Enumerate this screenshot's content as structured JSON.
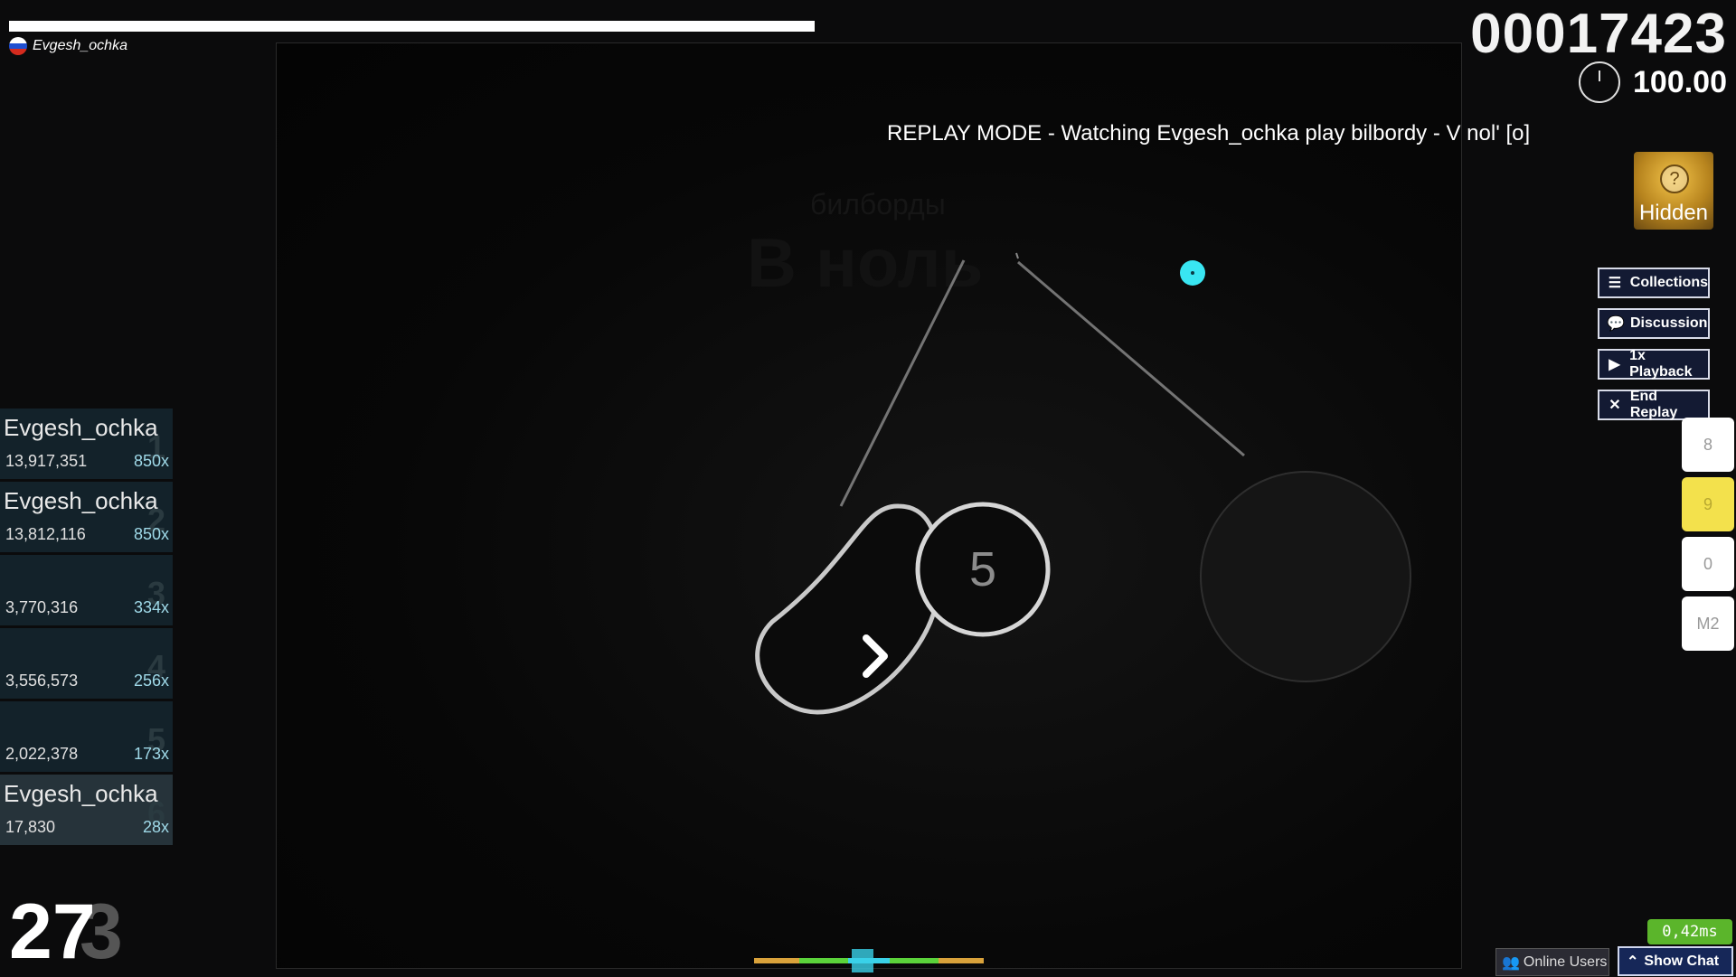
{
  "hud": {
    "player_name": "Evgesh_ochka",
    "score": "00017423",
    "accuracy": "100.00",
    "combo": "27",
    "combo_ghost": "3"
  },
  "replay_banner": "REPLAY MODE - Watching Evgesh_ochka play bilbordy - V nol' [o]",
  "background_titles": {
    "artist": "билборды",
    "title": "В ноль"
  },
  "mods": {
    "hidden_label": "Hidden",
    "hidden_glyph": "?"
  },
  "side_buttons": [
    {
      "label": "Collections",
      "icon": "list-icon"
    },
    {
      "label": "Discussion",
      "icon": "chat-bubbles-icon"
    },
    {
      "label": "1x Playback",
      "icon": "play-icon"
    },
    {
      "label": "End Replay",
      "icon": "close-icon"
    }
  ],
  "key_overlay": [
    {
      "label": "8",
      "active": false
    },
    {
      "label": "9",
      "active": true
    },
    {
      "label": "0",
      "active": false
    },
    {
      "label": "M2",
      "active": false
    }
  ],
  "leaderboard": [
    {
      "rank": "1",
      "name": "Evgesh_ochka",
      "score": "13,917,351",
      "combo": "850x"
    },
    {
      "rank": "2",
      "name": "Evgesh_ochka",
      "score": "13,812,116",
      "combo": "850x"
    },
    {
      "rank": "3",
      "name": "",
      "score": "3,770,316",
      "combo": "334x"
    },
    {
      "rank": "4",
      "name": "",
      "score": "3,556,573",
      "combo": "256x"
    },
    {
      "rank": "5",
      "name": "",
      "score": "2,022,378",
      "combo": "173x"
    },
    {
      "rank": "6",
      "name": "Evgesh_ochka",
      "score": "17,830",
      "combo": "28x"
    }
  ],
  "gameplay": {
    "slider_number": "5"
  },
  "status": {
    "ping": "0,42ms",
    "online_users": "Online Users",
    "show_chat": "Show Chat"
  },
  "colors": {
    "cursor": "#39e6f2",
    "key_active": "#f3e14c",
    "ping_bg": "#5bb52b",
    "button_bg": "#131a33"
  }
}
